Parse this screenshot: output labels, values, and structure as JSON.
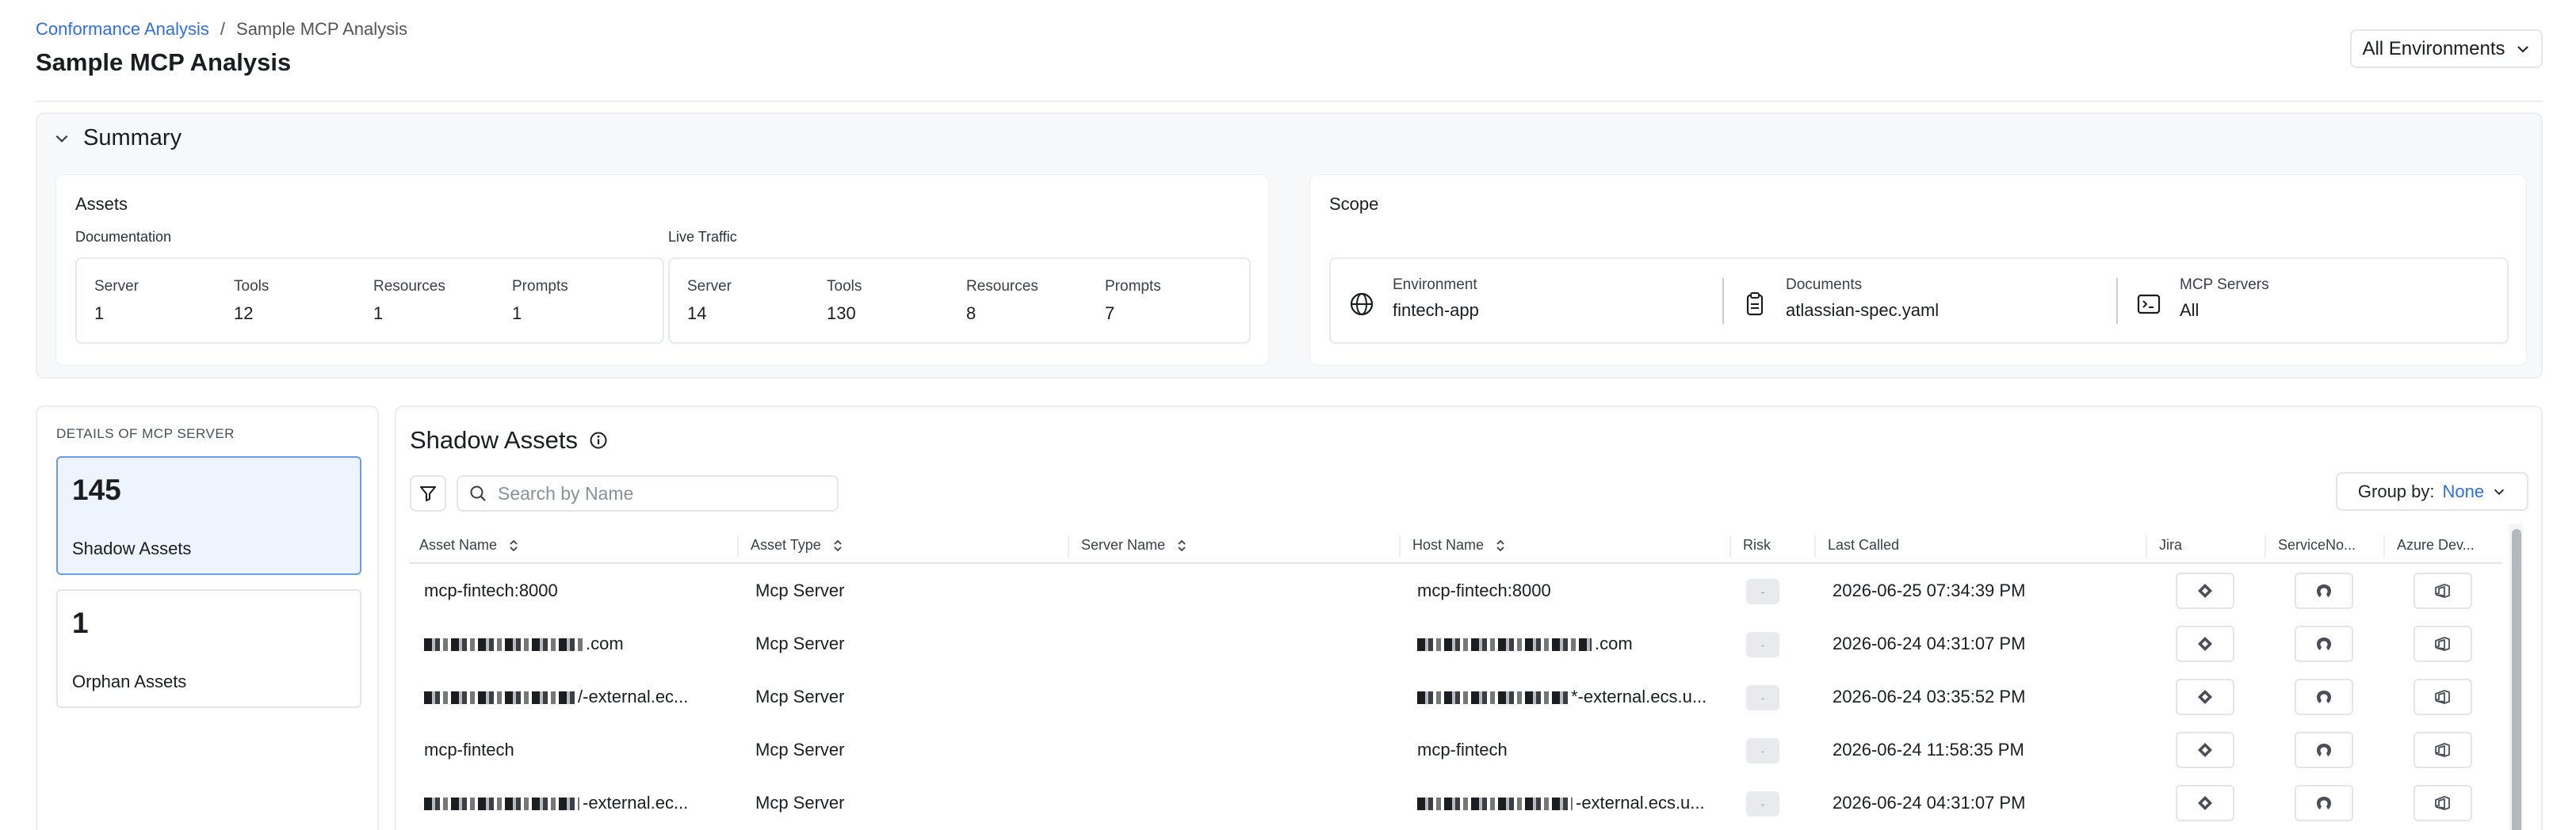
{
  "breadcrumb": {
    "parent": "Conformance Analysis",
    "separator": "/",
    "current": "Sample MCP Analysis"
  },
  "page_title": "Sample MCP Analysis",
  "environment_select": {
    "value": "All Environments",
    "icon": "chevron-down-icon"
  },
  "summary": {
    "title": "Summary",
    "assets": {
      "title": "Assets",
      "documentation": {
        "label": "Documentation",
        "stats": [
          {
            "label": "Server",
            "value": "1"
          },
          {
            "label": "Tools",
            "value": "12"
          },
          {
            "label": "Resources",
            "value": "1"
          },
          {
            "label": "Prompts",
            "value": "1"
          }
        ]
      },
      "live_traffic": {
        "label": "Live Traffic",
        "stats": [
          {
            "label": "Server",
            "value": "14"
          },
          {
            "label": "Tools",
            "value": "130"
          },
          {
            "label": "Resources",
            "value": "8"
          },
          {
            "label": "Prompts",
            "value": "7"
          }
        ]
      }
    },
    "scope": {
      "title": "Scope",
      "items": [
        {
          "label": "Environment",
          "value": "fintech-app",
          "icon": "globe-icon"
        },
        {
          "label": "Documents",
          "value": "atlassian-spec.yaml",
          "icon": "clipboard-icon"
        },
        {
          "label": "MCP Servers",
          "value": "All",
          "icon": "terminal-icon"
        }
      ]
    }
  },
  "details": {
    "heading": "DETAILS OF MCP SERVER",
    "cards": [
      {
        "count": "145",
        "label": "Shadow Assets",
        "active": true
      },
      {
        "count": "1",
        "label": "Orphan Assets",
        "active": false
      }
    ]
  },
  "shadow_assets": {
    "title": "Shadow Assets",
    "search_placeholder": "Search by Name",
    "group_by": {
      "label": "Group by:",
      "value": "None"
    },
    "columns": [
      "Asset Name",
      "Asset Type",
      "Server Name",
      "Host Name",
      "Risk",
      "Last Called",
      "Jira",
      "ServiceNo...",
      "Azure Dev..."
    ],
    "rows": [
      {
        "asset_name": "mcp-fintech:8000",
        "asset_type": "Mcp Server",
        "server_name": "",
        "host_name": "mcp-fintech:8000",
        "risk": "-",
        "last_called": "2026-06-25 07:34:39 PM"
      },
      {
        "asset_name": ".com",
        "asset_type": "Mcp Server",
        "server_name": "",
        "host_name": ".com",
        "risk": "-",
        "last_called": "2026-06-24 04:31:07 PM"
      },
      {
        "asset_name": "/-external.ec...",
        "asset_type": "Mcp Server",
        "server_name": "",
        "host_name": "*-external.ecs.u...",
        "risk": "-",
        "last_called": "2026-06-24 03:35:52 PM"
      },
      {
        "asset_name": "mcp-fintech",
        "asset_type": "Mcp Server",
        "server_name": "",
        "host_name": "mcp-fintech",
        "risk": "-",
        "last_called": "2026-06-24 11:58:35 PM"
      },
      {
        "asset_name": "-external.ec...",
        "asset_type": "Mcp Server",
        "server_name": "",
        "host_name": "-external.ecs.u...",
        "risk": "-",
        "last_called": "2026-06-24 04:31:07 PM"
      }
    ]
  }
}
